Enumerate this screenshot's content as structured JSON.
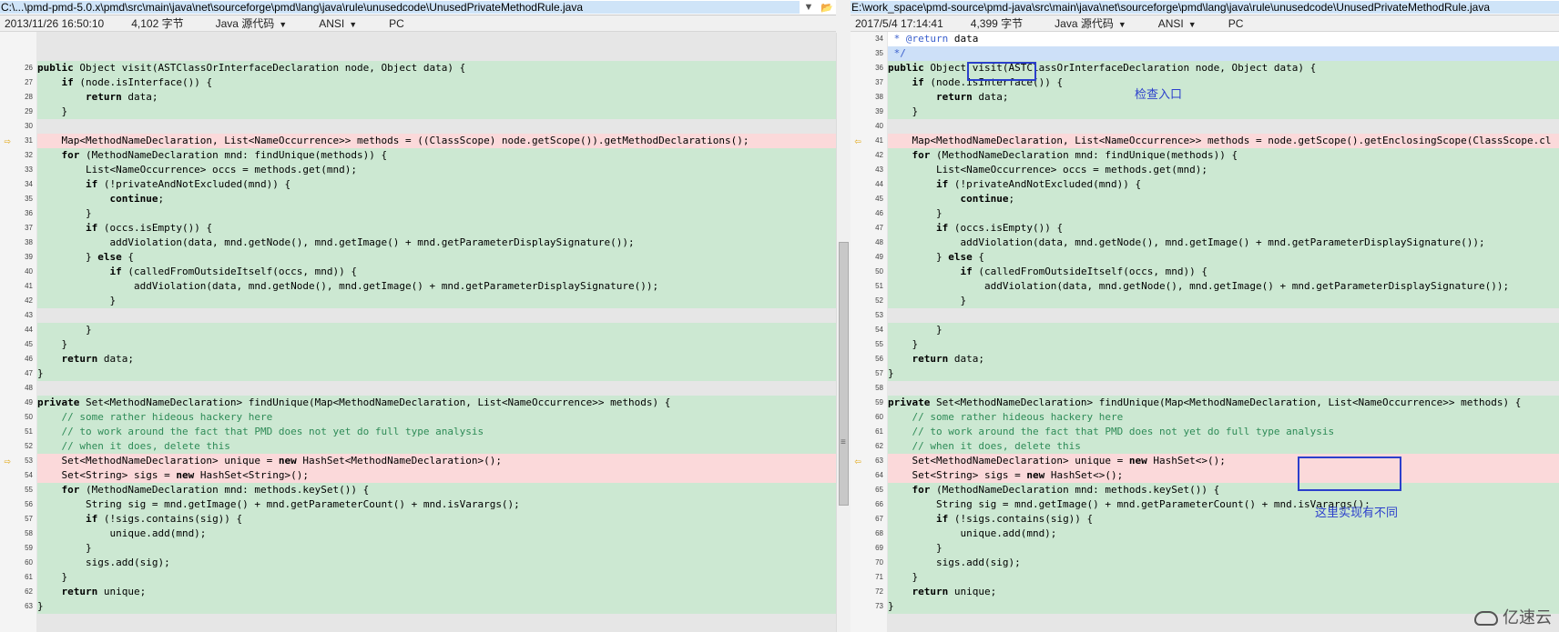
{
  "left": {
    "path": "C:\\...\\pmd-pmd-5.0.x\\pmd\\src\\main\\java\\net\\sourceforge\\pmd\\lang\\java\\rule\\unusedcode\\UnusedPrivateMethodRule.java",
    "status": {
      "datetime": "2013/11/26 16:50:10",
      "size": "4,102 字节",
      "language": "Java 源代码",
      "encoding": "ANSI",
      "lineend": "PC"
    },
    "lines": [
      {
        "n": "",
        "t": "",
        "k": "filler"
      },
      {
        "n": "",
        "t": "",
        "k": "filler"
      },
      {
        "n": "26",
        "t": "public Object visit(ASTClassOrInterfaceDeclaration node, Object data) {",
        "k": "same"
      },
      {
        "n": "27",
        "t": "    if (node.isInterface()) {",
        "k": "same"
      },
      {
        "n": "28",
        "t": "        return data;",
        "k": "same"
      },
      {
        "n": "29",
        "t": "    }",
        "k": "same"
      },
      {
        "n": "30",
        "t": "",
        "k": "same"
      },
      {
        "n": "31",
        "t": "    Map<MethodNameDeclaration, List<NameOccurrence>> methods = ((ClassScope) node.getScope()).getMethodDeclarations();",
        "k": "diff",
        "arrow": true
      },
      {
        "n": "32",
        "t": "    for (MethodNameDeclaration mnd: findUnique(methods)) {",
        "k": "same"
      },
      {
        "n": "33",
        "t": "        List<NameOccurrence> occs = methods.get(mnd);",
        "k": "same"
      },
      {
        "n": "34",
        "t": "        if (!privateAndNotExcluded(mnd)) {",
        "k": "same"
      },
      {
        "n": "35",
        "t": "            continue;",
        "k": "same"
      },
      {
        "n": "36",
        "t": "        }",
        "k": "same"
      },
      {
        "n": "37",
        "t": "        if (occs.isEmpty()) {",
        "k": "same"
      },
      {
        "n": "38",
        "t": "            addViolation(data, mnd.getNode(), mnd.getImage() + mnd.getParameterDisplaySignature());",
        "k": "same"
      },
      {
        "n": "39",
        "t": "        } else {",
        "k": "same"
      },
      {
        "n": "40",
        "t": "            if (calledFromOutsideItself(occs, mnd)) {",
        "k": "same"
      },
      {
        "n": "41",
        "t": "                addViolation(data, mnd.getNode(), mnd.getImage() + mnd.getParameterDisplaySignature());",
        "k": "same"
      },
      {
        "n": "42",
        "t": "            }",
        "k": "same"
      },
      {
        "n": "43",
        "t": "",
        "k": "same"
      },
      {
        "n": "44",
        "t": "        }",
        "k": "same"
      },
      {
        "n": "45",
        "t": "    }",
        "k": "same"
      },
      {
        "n": "46",
        "t": "    return data;",
        "k": "same"
      },
      {
        "n": "47",
        "t": "}",
        "k": "same"
      },
      {
        "n": "48",
        "t": "",
        "k": "same"
      },
      {
        "n": "49",
        "t": "private Set<MethodNameDeclaration> findUnique(Map<MethodNameDeclaration, List<NameOccurrence>> methods) {",
        "k": "same"
      },
      {
        "n": "50",
        "t": "    // some rather hideous hackery here",
        "k": "same"
      },
      {
        "n": "51",
        "t": "    // to work around the fact that PMD does not yet do full type analysis",
        "k": "same"
      },
      {
        "n": "52",
        "t": "    // when it does, delete this",
        "k": "same"
      },
      {
        "n": "53",
        "t": "    Set<MethodNameDeclaration> unique = new HashSet<MethodNameDeclaration>();",
        "k": "diff",
        "arrow": true
      },
      {
        "n": "54",
        "t": "    Set<String> sigs = new HashSet<String>();",
        "k": "diff"
      },
      {
        "n": "55",
        "t": "    for (MethodNameDeclaration mnd: methods.keySet()) {",
        "k": "same"
      },
      {
        "n": "56",
        "t": "        String sig = mnd.getImage() + mnd.getParameterCount() + mnd.isVarargs();",
        "k": "same"
      },
      {
        "n": "57",
        "t": "        if (!sigs.contains(sig)) {",
        "k": "same"
      },
      {
        "n": "58",
        "t": "            unique.add(mnd);",
        "k": "same"
      },
      {
        "n": "59",
        "t": "        }",
        "k": "same"
      },
      {
        "n": "60",
        "t": "        sigs.add(sig);",
        "k": "same"
      },
      {
        "n": "61",
        "t": "    }",
        "k": "same"
      },
      {
        "n": "62",
        "t": "    return unique;",
        "k": "same"
      },
      {
        "n": "63",
        "t": "}",
        "k": "same"
      }
    ]
  },
  "right": {
    "path": "E:\\work_space\\pmd-source\\pmd-java\\src\\main\\java\\net\\sourceforge\\pmd\\lang\\java\\rule\\unusedcode\\UnusedPrivateMethodRule.java",
    "status": {
      "datetime": "2017/5/4 17:14:41",
      "size": "4,399 字节",
      "language": "Java 源代码",
      "encoding": "ANSI",
      "lineend": "PC"
    },
    "lines": [
      {
        "n": "34",
        "t": " * @return data",
        "k": "head"
      },
      {
        "n": "35",
        "t": " */",
        "k": "sel"
      },
      {
        "n": "36",
        "t": "public Object visit(ASTClassOrInterfaceDeclaration node, Object data) {",
        "k": "same"
      },
      {
        "n": "37",
        "t": "    if (node.isInterface()) {",
        "k": "same"
      },
      {
        "n": "38",
        "t": "        return data;",
        "k": "same"
      },
      {
        "n": "39",
        "t": "    }",
        "k": "same"
      },
      {
        "n": "40",
        "t": "",
        "k": "same"
      },
      {
        "n": "41",
        "t": "    Map<MethodNameDeclaration, List<NameOccurrence>> methods = node.getScope().getEnclosingScope(ClassScope.cl",
        "k": "diff",
        "arrow": true
      },
      {
        "n": "42",
        "t": "    for (MethodNameDeclaration mnd: findUnique(methods)) {",
        "k": "same"
      },
      {
        "n": "43",
        "t": "        List<NameOccurrence> occs = methods.get(mnd);",
        "k": "same"
      },
      {
        "n": "44",
        "t": "        if (!privateAndNotExcluded(mnd)) {",
        "k": "same"
      },
      {
        "n": "45",
        "t": "            continue;",
        "k": "same"
      },
      {
        "n": "46",
        "t": "        }",
        "k": "same"
      },
      {
        "n": "47",
        "t": "        if (occs.isEmpty()) {",
        "k": "same"
      },
      {
        "n": "48",
        "t": "            addViolation(data, mnd.getNode(), mnd.getImage() + mnd.getParameterDisplaySignature());",
        "k": "same"
      },
      {
        "n": "49",
        "t": "        } else {",
        "k": "same"
      },
      {
        "n": "50",
        "t": "            if (calledFromOutsideItself(occs, mnd)) {",
        "k": "same"
      },
      {
        "n": "51",
        "t": "                addViolation(data, mnd.getNode(), mnd.getImage() + mnd.getParameterDisplaySignature());",
        "k": "same"
      },
      {
        "n": "52",
        "t": "            }",
        "k": "same"
      },
      {
        "n": "53",
        "t": "",
        "k": "same"
      },
      {
        "n": "54",
        "t": "        }",
        "k": "same"
      },
      {
        "n": "55",
        "t": "    }",
        "k": "same"
      },
      {
        "n": "56",
        "t": "    return data;",
        "k": "same"
      },
      {
        "n": "57",
        "t": "}",
        "k": "same"
      },
      {
        "n": "58",
        "t": "",
        "k": "same"
      },
      {
        "n": "59",
        "t": "private Set<MethodNameDeclaration> findUnique(Map<MethodNameDeclaration, List<NameOccurrence>> methods) {",
        "k": "same"
      },
      {
        "n": "60",
        "t": "    // some rather hideous hackery here",
        "k": "same"
      },
      {
        "n": "61",
        "t": "    // to work around the fact that PMD does not yet do full type analysis",
        "k": "same"
      },
      {
        "n": "62",
        "t": "    // when it does, delete this",
        "k": "same"
      },
      {
        "n": "63",
        "t": "    Set<MethodNameDeclaration> unique = new HashSet<>();",
        "k": "diff",
        "arrow": true
      },
      {
        "n": "64",
        "t": "    Set<String> sigs = new HashSet<>();",
        "k": "diff"
      },
      {
        "n": "65",
        "t": "    for (MethodNameDeclaration mnd: methods.keySet()) {",
        "k": "same"
      },
      {
        "n": "66",
        "t": "        String sig = mnd.getImage() + mnd.getParameterCount() + mnd.isVarargs();",
        "k": "same"
      },
      {
        "n": "67",
        "t": "        if (!sigs.contains(sig)) {",
        "k": "same"
      },
      {
        "n": "68",
        "t": "            unique.add(mnd);",
        "k": "same"
      },
      {
        "n": "69",
        "t": "        }",
        "k": "same"
      },
      {
        "n": "70",
        "t": "        sigs.add(sig);",
        "k": "same"
      },
      {
        "n": "71",
        "t": "    }",
        "k": "same"
      },
      {
        "n": "72",
        "t": "    return unique;",
        "k": "same"
      },
      {
        "n": "73",
        "t": "}",
        "k": "same"
      }
    ]
  },
  "annotations": {
    "entry_label": "检查入口",
    "diff_label": "这里实现有不同"
  },
  "watermark": {
    "text": "亿速云",
    "icon": "cloud-logo-icon"
  },
  "colors": {
    "same": "#cce8d2",
    "diff": "#fbd9da",
    "annotation": "#2b3fcc",
    "arrow": "#e0a000"
  }
}
